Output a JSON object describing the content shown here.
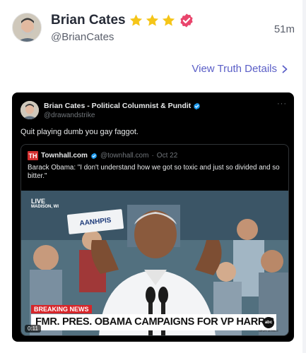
{
  "post": {
    "author_name": "Brian Cates",
    "handle": "@BrianCates",
    "time": "51m",
    "star_count": 3,
    "view_details_label": "View Truth Details",
    "icons": [
      "avatar",
      "star-icon",
      "verified-badge-icon",
      "chevron-right-icon"
    ]
  },
  "embed": {
    "author_name": "Brian Cates - Political Columnist & Pundit",
    "handle": "@drawandstrike",
    "more_label": "···",
    "text": "Quit playing dumb you gay faggot.",
    "quote": {
      "logo_text": "TH",
      "source_name": "Townhall.com",
      "handle": "@townhall.com",
      "separator": "·",
      "date": "Oct 22",
      "text": "Barack Obama: \"I don't understand how we got so toxic and just so divided and so bitter.\"",
      "video": {
        "live_label": "LIVE",
        "location": "MADISON, WI",
        "sign_text": "AANHPIS",
        "breaking_label": "BREAKING NEWS",
        "ticker_text": "FMR. PRES. OBAMA CAMPAIGNS FOR VP HARRIS",
        "network_logo": "abc",
        "network_sub": "NEWS MOBILE",
        "duration": "0:11"
      }
    }
  },
  "colors": {
    "link": "#5b5fc7",
    "star": "#f5c518",
    "verified": "#e9456c",
    "x_blue": "#1d9bf0",
    "card_bg": "#000000"
  }
}
